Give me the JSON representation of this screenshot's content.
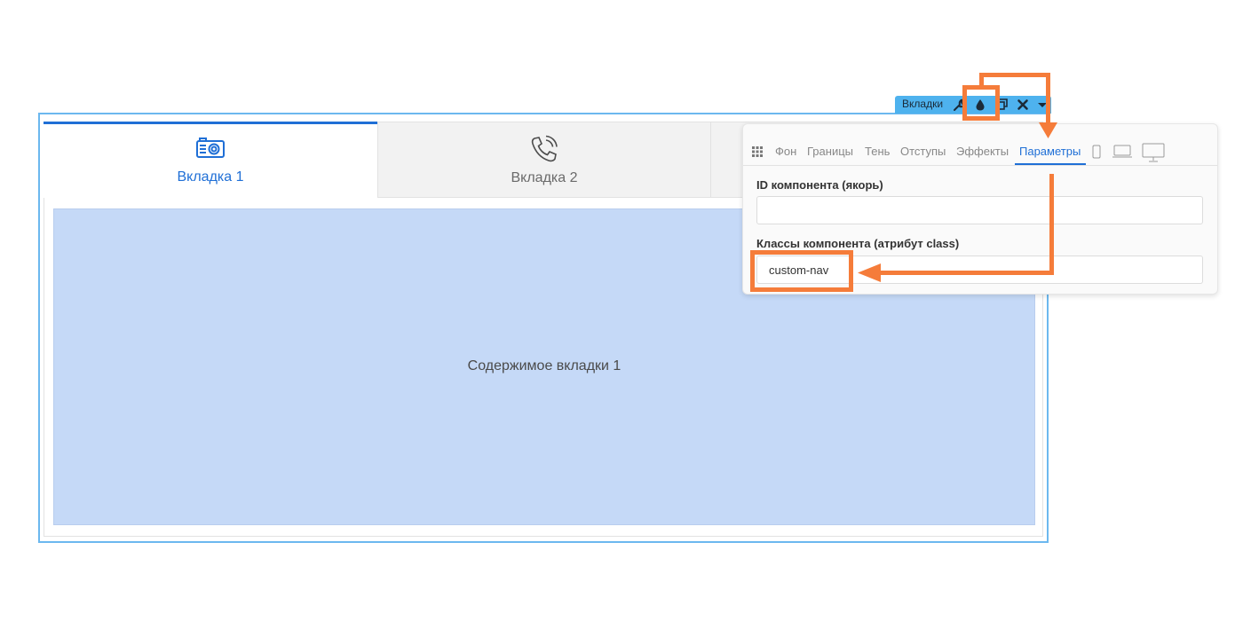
{
  "tabs": [
    {
      "label": "Вкладка 1",
      "icon": "camera-icon",
      "active": true
    },
    {
      "label": "Вкладка 2",
      "icon": "phone-ringing-icon",
      "active": false
    }
  ],
  "content": {
    "text": "Содержимое вкладки 1"
  },
  "toolbar": {
    "label": "Вкладки",
    "tools": [
      "wrench-icon",
      "drop-icon",
      "copy-icon",
      "close-icon",
      "caret-down-icon"
    ]
  },
  "panel": {
    "tabs": [
      "Фон",
      "Границы",
      "Тень",
      "Отступы",
      "Эффекты",
      "Параметры"
    ],
    "active_tab": "Параметры",
    "device_icons": [
      "mobile-icon",
      "laptop-icon",
      "desktop-icon"
    ],
    "id_field": {
      "label": "ID компонента (якорь)",
      "value": ""
    },
    "class_field": {
      "label": "Классы компонента (атрибут class)",
      "value": "custom-nav"
    }
  },
  "colors": {
    "accent": "#1f6fd6",
    "toolbar": "#4eb2ee",
    "content_bg": "#c5d9f7",
    "annotation": "#f57c3a"
  }
}
